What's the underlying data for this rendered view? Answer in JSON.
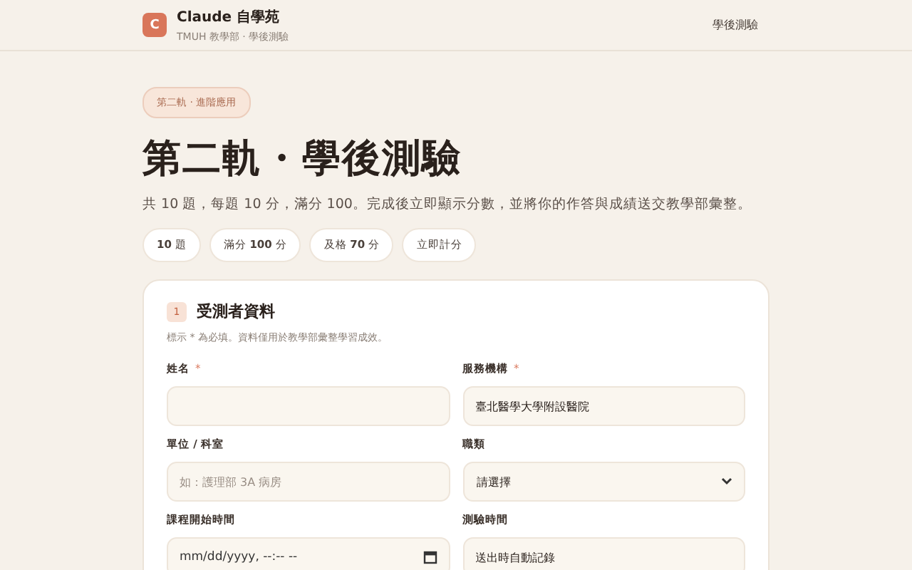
{
  "header": {
    "logo": "C",
    "title": "Claude 自學苑",
    "subtitle": "TMUH 教學部 · 學後測驗",
    "nav_link": "學後測驗"
  },
  "badge": "第二軌 · 進階應用",
  "title": "第二軌・學後測驗",
  "intro": "共 10 題，每題 10 分，滿分 100。完成後立即顯示分數，並將你的作答與成績送交教學部彙整。",
  "chips": [
    "**10** 題",
    "滿分 **100** 分",
    "及格 **70** 分",
    "立即計分"
  ],
  "section": {
    "number": "1",
    "title": "受測者資料",
    "note": "標示 * 為必填。資料僅用於教學部彙整學習成效。",
    "fields": [
      {
        "label": "姓名",
        "required_mark": "*",
        "kind": "text"
      },
      {
        "label": "服務機構",
        "required_mark": "*",
        "kind": "text",
        "value": "臺北醫學大學附設醫院"
      },
      {
        "label": "單位 / 科室",
        "kind": "text",
        "placeholder": "如：護理部 3A 病房"
      },
      {
        "label": "職類",
        "kind": "select",
        "value": "請選擇"
      },
      {
        "label": "課程開始時間",
        "kind": "datetime",
        "placeholder": "mm/dd/yyyy, --:-- --"
      },
      {
        "label": "測驗時間",
        "kind": "text",
        "value": "送出時自動記錄"
      }
    ]
  }
}
